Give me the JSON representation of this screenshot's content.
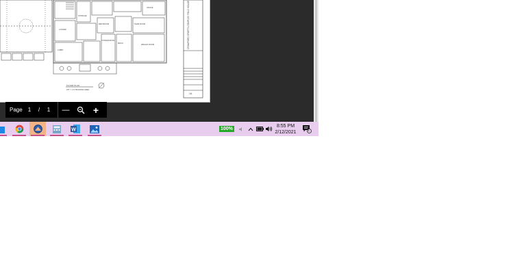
{
  "viewer": {
    "page_label": "Page",
    "current_page": "1",
    "page_separator": "/",
    "total_pages": "1",
    "zoom_out_label": "—",
    "zoom_in_label": "+"
  },
  "document": {
    "title_block_text": "CRAWFORD SPORTS COMPLEX FIELD HOUSE",
    "sheet_number": "1A",
    "plan_label": "FLOOR PLAN",
    "plan_sublabel": "1/8\" = 1'-0\" BUILDING AREA",
    "room_labels": [
      "LOBBY",
      "STORAGE",
      "OFFICE",
      "LOCKER",
      "CONCESSIONS",
      "MECH",
      "RESTROOM",
      "TEAM ROOM",
      "WEIGHT ROOM"
    ]
  },
  "taskbar": {
    "apps": [
      {
        "name": "file-explorer",
        "icon": "folder-icon",
        "color": "#1e88e5"
      },
      {
        "name": "chrome",
        "icon": "chrome-icon",
        "color": "#db4437"
      },
      {
        "name": "app-blue-circle",
        "icon": "circle-app-icon",
        "color": "#2e5ca8",
        "active": true
      },
      {
        "name": "calculator",
        "icon": "calculator-icon",
        "color": "#7aa6c8"
      },
      {
        "name": "word",
        "icon": "word-icon",
        "color": "#2b579a"
      },
      {
        "name": "photos",
        "icon": "photos-icon",
        "color": "#1f63b8"
      }
    ],
    "battery_percent": "100%",
    "time": "8:55 PM",
    "date": "2/12/2021",
    "notification_count": "1"
  }
}
